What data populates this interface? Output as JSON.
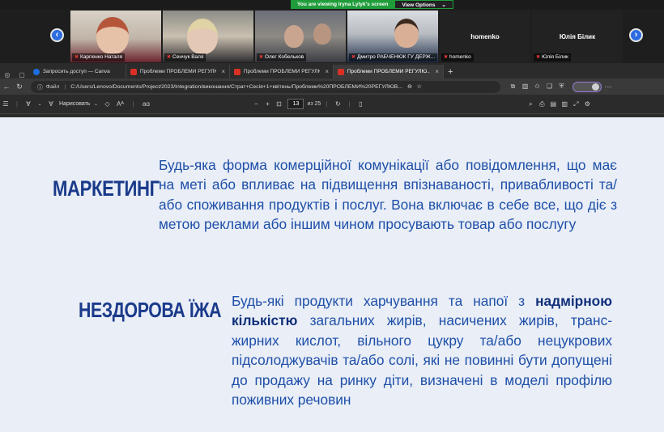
{
  "banner": {
    "viewing_text": "You are viewing Iryna Lylyk's screen",
    "view_options_label": "View Options",
    "view_options_chevron": "⌄"
  },
  "participants": [
    {
      "name": "Карпенко Наталя",
      "muted": true
    },
    {
      "name": "Сенчук Валя",
      "muted": true
    },
    {
      "name": "Олег Кобельков",
      "muted": true
    },
    {
      "name": "Дмитро РАБЧЕНЮК ГУ ДЕРЖ...",
      "muted": true
    },
    {
      "name": "homenko",
      "muted": true,
      "tile_label": "homenko"
    },
    {
      "name": "Юлія Білик",
      "muted": true,
      "tile_label": "Юлія Білик"
    }
  ],
  "tabs": [
    {
      "label": "Запросить доступ — Canva",
      "icon_color": "#1b6fe0"
    },
    {
      "label": "Проблеми ПРОБЛЕМИ РЕГУЛЮ...",
      "icon_color": "#d93025"
    },
    {
      "label": "Проблеми ПРОБЛЕМИ РЕГУЛЮ...",
      "icon_color": "#d93025"
    },
    {
      "label": "Проблеми ПРОБЛЕМИ РЕГУЛЮ...",
      "icon_color": "#d93025",
      "active": true
    }
  ],
  "address": {
    "scheme_label": "Файл",
    "path": "C:/Users/Lenovo/Documents/Project/2023/Integration/виконання/Страт+Сесія+1+квітень/Проблеми%20ПРОБЛЕМИ%20РЕГУЛЮВ..."
  },
  "pdf_toolbar": {
    "draw_label": "Нарисовать",
    "page_current": "13",
    "page_total_label": "из 25",
    "zoom_minus": "−",
    "zoom_plus": "+",
    "read_aloud": "Aᴬ",
    "translate": "aɑ"
  },
  "content": {
    "term1": "МАРКЕТИНГ",
    "def1": "Будь-яка форма комерційної комунікації або повідомлення, що має на меті або впливає на підвищення впізнаваності, привабливості та/або споживання продуктів і послуг. Вона включає в себе все, що діє з метою реклами або іншим чином просувають товар або послугу",
    "term2": "НЕЗДОРОВА ЇЖА",
    "def2_pre": "Будь-які продукти харчування та напої з ",
    "def2_bold": "надмірною кількістю",
    "def2_post": " загальних жирів, насичених жирів, транс-жирних кислот, вільного цукру та/або нецукрових підсолоджувачів та/або солі, які не повинні бути допущені до продажу на ринку діти, визначені в моделі профілю поживних речовин"
  },
  "colors": {
    "term": "#1a3a8a",
    "text": "#1e4fa8",
    "page_bg": "#e9eef7",
    "banner_green": "#1f9d3a",
    "nav_blue": "#2d6cdf"
  }
}
